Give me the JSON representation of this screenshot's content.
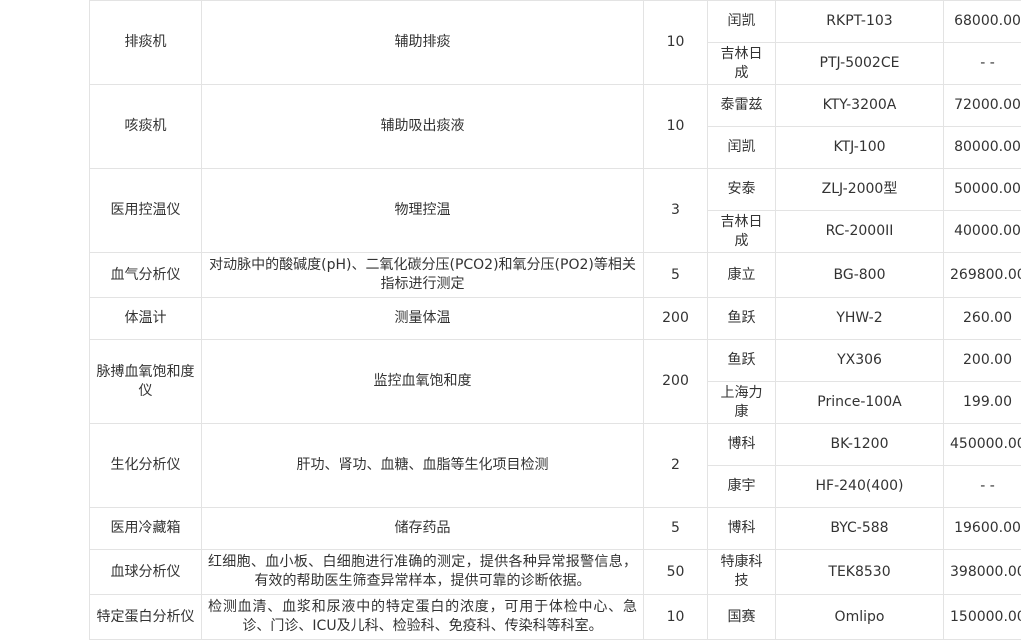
{
  "rows": [
    {
      "name": "排痰机",
      "function": "辅助排痰",
      "qty": "10",
      "suppliers": [
        {
          "brand": "闰凯",
          "model": "RKPT-103",
          "price": "68000.00"
        },
        {
          "brand": "吉林日成",
          "model": "PTJ-5002CE",
          "price": "- -"
        }
      ]
    },
    {
      "name": "咳痰机",
      "function": "辅助吸出痰液",
      "qty": "10",
      "suppliers": [
        {
          "brand": "泰雷兹",
          "model": "KTY-3200A",
          "price": "72000.00"
        },
        {
          "brand": "闰凯",
          "model": "KTJ-100",
          "price": "80000.00"
        }
      ]
    },
    {
      "name": "医用控温仪",
      "function": "物理控温",
      "qty": "3",
      "suppliers": [
        {
          "brand": "安泰",
          "model": "ZLJ-2000型",
          "price": "50000.00"
        },
        {
          "brand": "吉林日成",
          "model": "RC-2000II",
          "price": "40000.00"
        }
      ]
    },
    {
      "name": "血气分析仪",
      "function": "对动脉中的酸碱度(pH)、二氧化碳分压(PCO2)和氧分压(PO2)等相关指标进行测定",
      "qty": "5",
      "suppliers": [
        {
          "brand": "康立",
          "model": "BG-800",
          "price": "269800.00"
        }
      ]
    },
    {
      "name": "体温计",
      "function": "测量体温",
      "qty": "200",
      "suppliers": [
        {
          "brand": "鱼跃",
          "model": "YHW-2",
          "price": "260.00"
        }
      ]
    },
    {
      "name": "脉搏血氧饱和度仪",
      "function": "监控血氧饱和度",
      "qty": "200",
      "suppliers": [
        {
          "brand": "鱼跃",
          "model": "YX306",
          "price": "200.00"
        },
        {
          "brand": "上海力康",
          "model": "Prince-100A",
          "price": "199.00"
        }
      ]
    },
    {
      "name": "生化分析仪",
      "function": "肝功、肾功、血糖、血脂等生化项目检测",
      "qty": "2",
      "suppliers": [
        {
          "brand": "博科",
          "model": "BK-1200",
          "price": "450000.00"
        },
        {
          "brand": "康宇",
          "model": "HF-240(400)",
          "price": "- -"
        }
      ]
    },
    {
      "name": "医用冷藏箱",
      "function": "储存药品",
      "qty": "5",
      "suppliers": [
        {
          "brand": "博科",
          "model": "BYC-588",
          "price": "19600.00"
        }
      ]
    },
    {
      "name": "血球分析仪",
      "function": "红细胞、血小板、白细胞进行准确的测定，提供各种异常报警信息，有效的帮助医生筛查异常样本，提供可靠的诊断依据。",
      "qty": "50",
      "suppliers": [
        {
          "brand": "特康科技",
          "model": "TEK8530",
          "price": "398000.00"
        }
      ]
    },
    {
      "name": "特定蛋白分析仪",
      "function": "检测血清、血浆和尿液中的特定蛋白的浓度，可用于体检中心、急诊、门诊、ICU及儿科、检验科、免疫科、传染科等科室。",
      "qty": "10",
      "suppliers": [
        {
          "brand": "国赛",
          "model": "Omlipo",
          "price": "150000.00"
        }
      ]
    }
  ]
}
